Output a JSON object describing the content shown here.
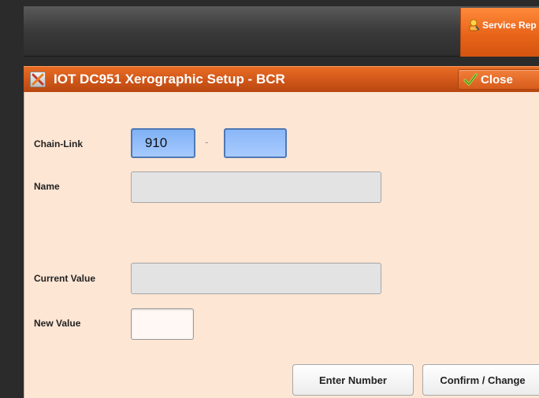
{
  "header": {
    "service_tab_label": "Service Rep",
    "service_icon": "service-rep-icon"
  },
  "title_bar": {
    "title": "IOT DC951 Xerographic Setup - BCR",
    "icon": "tools-icon",
    "close_label": "Close",
    "close_icon": "checkmark-icon"
  },
  "form": {
    "chain_link_label": "Chain-Link",
    "chain_value": "910",
    "link_value": "",
    "separator": "-",
    "name_label": "Name",
    "name_value": "",
    "current_value_label": "Current Value",
    "current_value": "",
    "new_value_label": "New Value",
    "new_value": ""
  },
  "actions": {
    "enter_number_label": "Enter Number",
    "confirm_change_label": "Confirm / Change"
  },
  "colors": {
    "accent_orange": "#e8641a",
    "panel_background": "#fde6d4",
    "field_blue": "#8ab7f7"
  }
}
